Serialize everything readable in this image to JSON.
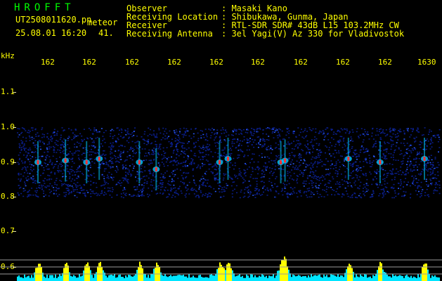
{
  "header": {
    "brand": "HROFFT",
    "filename": "UT2508011620.pn",
    "mode": "meteor",
    "datetime": "25.08.01 16:20",
    "value": "41.",
    "rows": [
      {
        "label": "Observer",
        "value": ": Masaki Kano"
      },
      {
        "label": "Receiving Location",
        "value": ": Shibukawa, Gunma, Japan"
      },
      {
        "label": "Receiver",
        "value": ": RTL-SDR SDR# 43dB L15 103.2MHz CW"
      },
      {
        "label": "Receiving Antenna",
        "value": ": 3el Yagi(V) Az 330 for Vladivostok"
      }
    ]
  },
  "axis": {
    "unit": "kHz",
    "y_ticks": [
      "1.1",
      "1.0",
      "0.9",
      "0.8",
      "0.7",
      "0.6"
    ],
    "x_ticks": [
      "162",
      "162",
      "162",
      "162",
      "162",
      "162",
      "162",
      "162",
      "162",
      "1630"
    ]
  },
  "colors": {
    "text": "#ffff00",
    "brand": "#00ff00",
    "background": "#000000",
    "noise": "#0a1e8c",
    "signal": "#00c8ff",
    "peak": "#ff3030",
    "level_bars": "#00e5ff"
  },
  "chart_data": {
    "type": "heatmap",
    "ylabel": "kHz",
    "ylim": [
      0.59,
      1.14
    ],
    "signal_band_khz": [
      0.8,
      1.0
    ],
    "meteor_echoes": [
      {
        "t": 0.05,
        "f": 0.9
      },
      {
        "t": 0.115,
        "f": 0.905
      },
      {
        "t": 0.165,
        "f": 0.9
      },
      {
        "t": 0.195,
        "f": 0.91
      },
      {
        "t": 0.29,
        "f": 0.9
      },
      {
        "t": 0.33,
        "f": 0.88
      },
      {
        "t": 0.48,
        "f": 0.9
      },
      {
        "t": 0.5,
        "f": 0.91
      },
      {
        "t": 0.625,
        "f": 0.9
      },
      {
        "t": 0.635,
        "f": 0.905
      },
      {
        "t": 0.785,
        "f": 0.91
      },
      {
        "t": 0.86,
        "f": 0.9
      },
      {
        "t": 0.965,
        "f": 0.91
      }
    ]
  }
}
